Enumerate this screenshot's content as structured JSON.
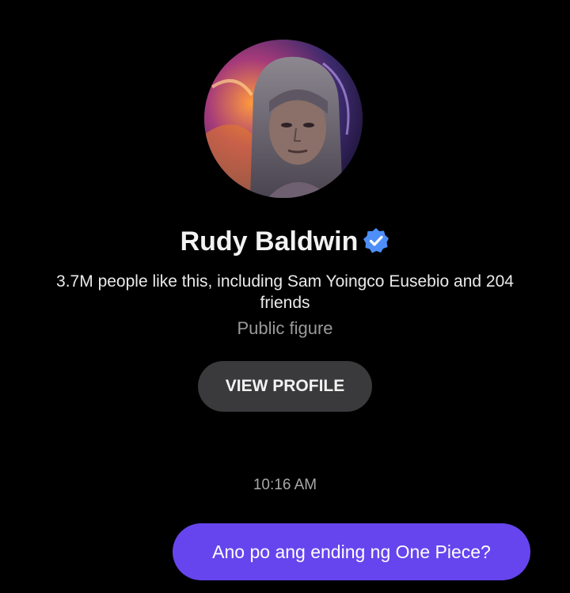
{
  "profile": {
    "name": "Rudy Baldwin",
    "verified_icon": "verified-badge-icon",
    "likes_text": "3.7M people like this, including Sam Yoingco Eusebio and 204 friends",
    "category": "Public figure",
    "view_profile_label": "VIEW PROFILE"
  },
  "chat": {
    "timestamp": "10:16 AM",
    "messages": [
      {
        "text": "Ano po ang ending ng One Piece?",
        "sender": "self"
      }
    ]
  },
  "colors": {
    "background": "#000000",
    "button_bg": "#3a3a3c",
    "outgoing_bubble": "#6645ee",
    "verified_badge": "#4d8ef7",
    "muted_text": "#9a9a9a"
  }
}
